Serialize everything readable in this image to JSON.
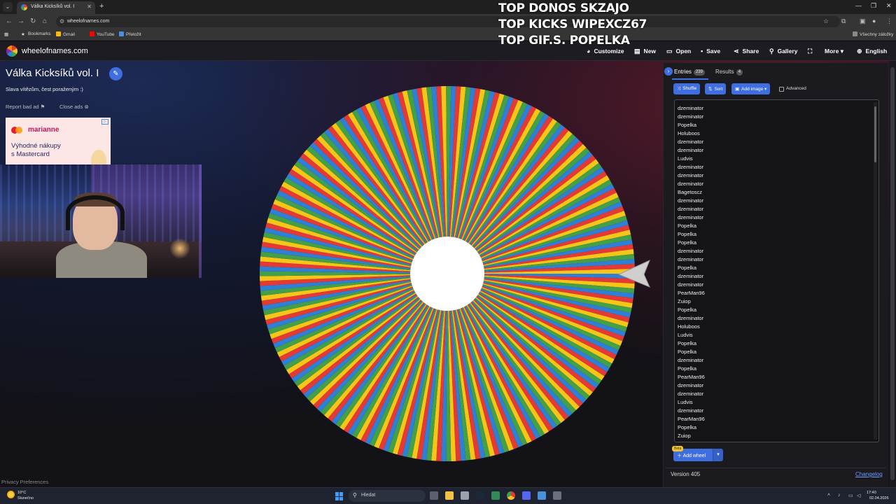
{
  "browser": {
    "tab_title": "Válka Kicksíků vol. I",
    "url": "wheelofnames.com",
    "bookmarks": [
      "Bookmarks",
      "Gmail",
      "YouTube",
      "Přeložit"
    ],
    "all_bookmarks": "Všechny záložky"
  },
  "overlay": {
    "lines": [
      "TOP DONOS SKZAJO",
      "TOP KICKS WIPEXCZ67",
      "TOP GIF.S.  POPELKA"
    ]
  },
  "header": {
    "logo_text": "wheelofnames.com",
    "menu": {
      "customize": "Customize",
      "new": "New",
      "open": "Open",
      "save": "Save",
      "share": "Share",
      "gallery": "Gallery",
      "more": "More",
      "language": "English"
    }
  },
  "left": {
    "title": "Válka Kicksíků vol. I",
    "subtitle": "Slava vítězům, čest poraženým :)",
    "report_ad": "Report bad ad",
    "close_ads": "Close ads",
    "ad": {
      "brand": "marianne",
      "line1": "Výhodné nákupy",
      "line2": "s Mastercard"
    },
    "privacy": "Privacy Preferences"
  },
  "wheel": {
    "segment_colors": [
      "#2f7fd6",
      "#e53935",
      "#f5c518",
      "#43a047"
    ],
    "segment_count": 239
  },
  "panel": {
    "tab_entries": "Entries",
    "entries_count": "239",
    "tab_results": "Results",
    "results_count": "4",
    "buttons": {
      "shuffle": "Shuffle",
      "sort": "Sort",
      "add_image": "Add image",
      "advanced": "Advanced"
    },
    "entries": [
      "dzeminator",
      "dzeminator",
      "Popelka",
      "Holuboos",
      "dzeminator",
      "dzeminator",
      "Ludvis",
      "dzeminator",
      "dzeminator",
      "dzeminator",
      "Bagetoscz",
      "dzeminator",
      "dzeminator",
      "dzeminator",
      "Popelka",
      "Popelka",
      "Popelka",
      "dzeminator",
      "dzeminator",
      "Popelka",
      "dzeminator",
      "dzeminator",
      "PearMan96",
      "Zuiop",
      "Popelka",
      "dzeminator",
      "Holuboos",
      "Ludvis",
      "Popelka",
      "Popelka",
      "dzeminator",
      "Popelka",
      "PearMan96",
      "dzeminator",
      "dzeminator",
      "Ludvis",
      "dzeminator",
      "PearMan96",
      "Popelka",
      "Zuiop"
    ],
    "beta": "Beta",
    "add_wheel": "Add wheel",
    "version": "Version 405",
    "changelog": "Changelog"
  },
  "taskbar": {
    "weather_temp": "10°C",
    "weather_desc": "Slunečno",
    "search": "Hledat",
    "time": "17:40",
    "date": "02.04.2026"
  }
}
